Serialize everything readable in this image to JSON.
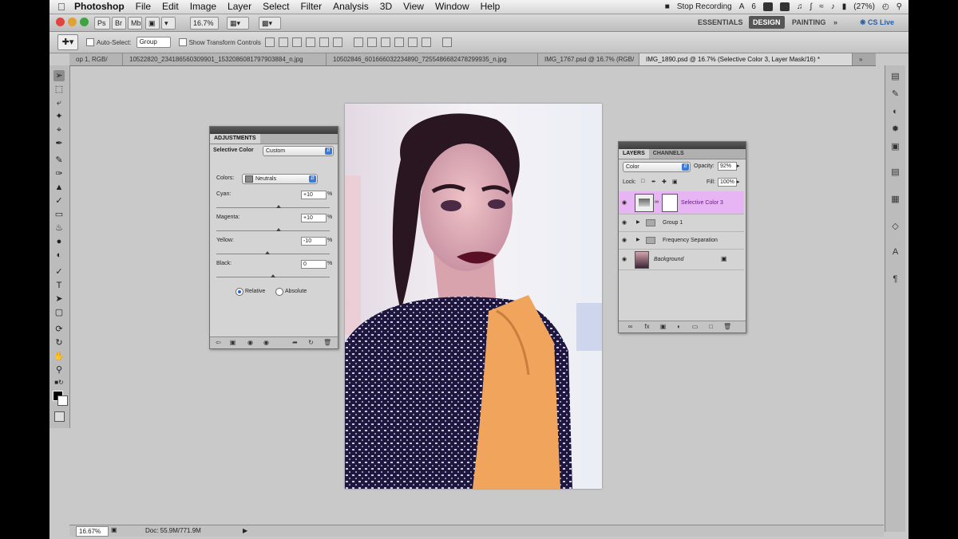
{
  "menubar": {
    "items": [
      "Photoshop",
      "File",
      "Edit",
      "Image",
      "Layer",
      "Select",
      "Filter",
      "Analysis",
      "3D",
      "View",
      "Window",
      "Help"
    ],
    "status": {
      "recording": "Stop Recording",
      "adobe_num": "6",
      "battery": "(27%)"
    }
  },
  "appbar": {
    "zoom": "16.7%",
    "workspaces": [
      "ESSENTIALS",
      "DESIGN",
      "PAINTING"
    ],
    "cs_live": "CS Live"
  },
  "options": {
    "auto_select": "Auto-Select:",
    "auto_select_value": "Group",
    "show_transform": "Show Transform Controls"
  },
  "doc_tabs": [
    "op 1, RGB/",
    "10522820_234186560309901_1532086081797903884_n.jpg",
    "10502846_601666032234890_7255486682478299935_n.jpg",
    "IMG_1767.psd @ 16.7% (RGB/",
    "IMG_1890.psd @ 16.7% (Selective Color 3, Layer Mask/16) *"
  ],
  "statusbar": {
    "zoom": "16.67%",
    "doc": "Doc: 55.9M/771.9M"
  },
  "adjustments": {
    "tab": "ADJUSTMENTS",
    "title": "Selective Color",
    "preset": "Custom",
    "colors_label": "Colors:",
    "colors_value": "Neutrals",
    "sliders": [
      {
        "label": "Cyan:",
        "value": "+10",
        "unit": "%",
        "pos": 0.55
      },
      {
        "label": "Magenta:",
        "value": "+10",
        "unit": "%",
        "pos": 0.55
      },
      {
        "label": "Yellow:",
        "value": "-10",
        "unit": "%",
        "pos": 0.45
      },
      {
        "label": "Black:",
        "value": "0",
        "unit": "%",
        "pos": 0.5
      }
    ],
    "relative": "Relative",
    "absolute": "Absolute"
  },
  "layers": {
    "tabs": [
      "LAYERS",
      "CHANNELS"
    ],
    "blend_mode": "Color",
    "opacity_label": "Opacity:",
    "opacity_value": "92%",
    "lock_label": "Lock:",
    "fill_label": "Fill:",
    "fill_value": "100%",
    "rows": [
      {
        "name": "Selective Color 3"
      },
      {
        "name": "Group 1"
      },
      {
        "name": "Frequency Separation"
      },
      {
        "name": "Background"
      }
    ]
  }
}
